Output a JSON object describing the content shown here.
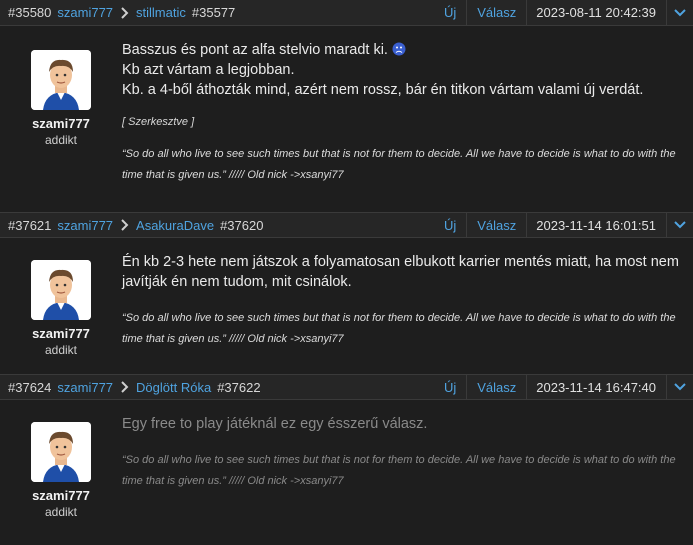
{
  "posts": [
    {
      "post_id": "#35580",
      "user": "szami777",
      "reply_to_user": "stillmatic",
      "reply_to_id": "#35577",
      "new_label": "Új",
      "reply_label": "Válasz",
      "date": "2023-08-11 20:42:39",
      "author_name": "szami777",
      "author_rank": "addikt",
      "lines": [
        "Basszus és pont az alfa stelvio maradt ki.",
        "Kb azt vártam a legjobban.",
        "Kb. a 4-ből áthozták mind, azért nem rossz, bár én titkon vártam valami új verdát."
      ],
      "edited": "[ Szerkesztve ]",
      "signature": "“So do all who live to see such times but that is not for them to decide. All we have to decide is what to do with the time that is given us.” ///// Old nick ->xsanyi77"
    },
    {
      "post_id": "#37621",
      "user": "szami777",
      "reply_to_user": "AsakuraDave",
      "reply_to_id": "#37620",
      "new_label": "Új",
      "reply_label": "Válasz",
      "date": "2023-11-14 16:01:51",
      "author_name": "szami777",
      "author_rank": "addikt",
      "text": "Én kb 2-3 hete nem játszok a folyamatosan elbukott karrier mentés miatt, ha most nem javítják én nem tudom, mit csinálok.",
      "signature": "“So do all who live to see such times but that is not for them to decide. All we have to decide is what to do with the time that is given us.” ///// Old nick ->xsanyi77"
    },
    {
      "post_id": "#37624",
      "user": "szami777",
      "reply_to_user": "Döglött Róka",
      "reply_to_id": "#37622",
      "new_label": "Új",
      "reply_label": "Válasz",
      "date": "2023-11-14 16:47:40",
      "author_name": "szami777",
      "author_rank": "addikt",
      "text": "Egy free to play játéknál ez egy ésszerű válasz.",
      "signature": "“So do all who live to see such times but that is not for them to decide. All we have to decide is what to do with the time that is given us.” ///// Old nick ->xsanyi77"
    }
  ],
  "colors": {
    "link": "#4fa3e0",
    "background": "#1e1e1e",
    "header": "#262626"
  },
  "icons": {
    "reply_arrow": "chevron-right-icon",
    "menu": "chevron-down-icon",
    "emoji": "sad-face-icon"
  }
}
